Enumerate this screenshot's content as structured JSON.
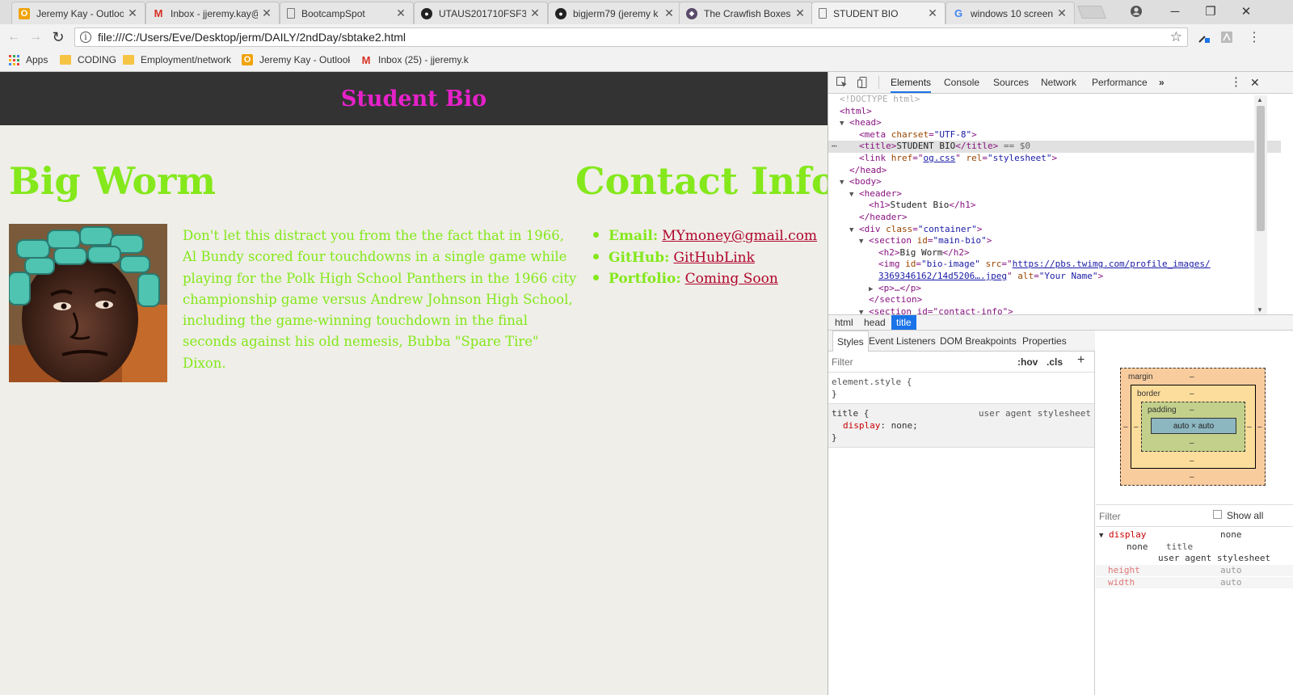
{
  "browser": {
    "tabs": [
      {
        "title": "Jeremy Kay - Outloo",
        "icon": "outlook-icon",
        "color": "#f0a30a"
      },
      {
        "title": "Inbox - jjeremy.kay@",
        "icon": "gmail-icon",
        "color": "#d93025"
      },
      {
        "title": "BootcampSpot",
        "icon": "page-icon",
        "color": "#777777"
      },
      {
        "title": "UTAUS201710FSF3-",
        "icon": "github-icon",
        "color": "#222222"
      },
      {
        "title": "bigjerm79 (jeremy k",
        "icon": "github-icon",
        "color": "#222222"
      },
      {
        "title": "The Crawfish Boxes,",
        "icon": "site-icon",
        "color": "#5a4a6a"
      },
      {
        "title": "STUDENT BIO",
        "icon": "page-icon",
        "color": "#777777"
      },
      {
        "title": "windows 10 screen c",
        "icon": "google-icon",
        "color": "#4285f4"
      }
    ],
    "url": "file:///C:/Users/Eve/Desktop/jerm/DAILY/2ndDay/sbtake2.html",
    "bookmarks": [
      {
        "label": "Apps",
        "icon": "apps-grid-icon"
      },
      {
        "label": "CODING",
        "icon": "folder-icon"
      },
      {
        "label": "Employment/network",
        "icon": "folder-icon"
      },
      {
        "label": "Jeremy Kay - Outlook",
        "icon": "outlook-icon"
      },
      {
        "label": "Inbox (25) - jjeremy.k",
        "icon": "gmail-icon"
      }
    ]
  },
  "page": {
    "header_title": "Student Bio",
    "bio_heading": "Big Worm",
    "contact_heading": "Contact Info",
    "bio_text": "Don't let this distract you from the the fact that in 1966, Al Bundy scored four touchdowns in a single game while playing for the Polk High School Panthers in the 1966 city championship game versus Andrew Johnson High School, including the game-winning touchdown in the final seconds against his old nemesis, Bubba \"Spare Tire\" Dixon.",
    "contacts": [
      {
        "label": "Email:",
        "value": "MYmoney@gmail.com"
      },
      {
        "label": "GitHub:",
        "value": "GitHubLink"
      },
      {
        "label": "Portfolio:",
        "value": "Coming Soon"
      }
    ],
    "colors": {
      "heading_green": "#84e81b",
      "header_magenta": "#e621c9",
      "link_red": "#b0052d",
      "header_bg": "#333333",
      "page_bg": "#efeee8"
    }
  },
  "devtools": {
    "tabs": [
      "Elements",
      "Console",
      "Sources",
      "Network",
      "Performance"
    ],
    "active_tab": "Elements",
    "dom": {
      "doctype": "<!DOCTYPE html>",
      "html_open": "<html>",
      "head_open": "<head>",
      "meta_tag": "meta",
      "meta_attr": "charset",
      "meta_val": "\"UTF-8\"",
      "title_tag_open": "<title>",
      "title_text": "STUDENT BIO",
      "title_tag_close": "</title>",
      "selected_marker": "== $0",
      "link_tag": "link",
      "link_href_attr": "href",
      "link_href_val": "og.css",
      "link_rel_attr": "rel",
      "link_rel_val": "\"stylesheet\"",
      "head_close": "</head>",
      "body_open": "<body>",
      "header_open": "<header>",
      "h1_open": "<h1>",
      "h1_text": "Student Bio",
      "h1_close": "</h1>",
      "header_close": "</header>",
      "div_tag": "div",
      "div_class_attr": "class",
      "div_class_val": "\"container\"",
      "section_tag": "section",
      "section_id_attr": "id",
      "section_id_val": "\"main-bio\"",
      "h2_open": "<h2>",
      "h2_text": "Big Worm",
      "h2_close": "</h2>",
      "img_tag": "img",
      "img_id_attr": "id",
      "img_id_val": "\"bio-image\"",
      "img_src_attr": "src",
      "img_src_val_1": "https://pbs.twimg.com/profile_images/",
      "img_src_val_2": "3369346162/14d5206….jpeg",
      "img_alt_attr": "alt",
      "img_alt_val": "\"Your Name\"",
      "p_collapsed": "<p>…</p>",
      "section_close": "</section>",
      "section2_partial": "<section id=\"contact-info\">"
    },
    "breadcrumbs": [
      "html",
      "head",
      "title"
    ],
    "active_crumb": "title",
    "sub_tabs": [
      "Styles",
      "Event Listeners",
      "DOM Breakpoints",
      "Properties"
    ],
    "filter_placeholder": "Filter",
    "hov": ":hov",
    "cls": ".cls",
    "element_style": "element.style {",
    "rule_selector": "title {",
    "rule_source": "user agent stylesheet",
    "rule_prop": "display",
    "rule_value": "none;",
    "close_brace": "}",
    "box_model": {
      "margin": "margin",
      "border": "border",
      "padding": "padding",
      "dash": "–",
      "content": "auto × auto"
    },
    "computed": {
      "filter_placeholder": "Filter",
      "show_all": "Show all",
      "display_prop": "display",
      "display_val": "none",
      "display_sub_val": "none",
      "display_sub_sel": "title",
      "display_sub_src": "user agent stylesheet",
      "height_prop": "height",
      "height_val": "auto",
      "width_prop": "width",
      "width_val": "auto"
    }
  }
}
